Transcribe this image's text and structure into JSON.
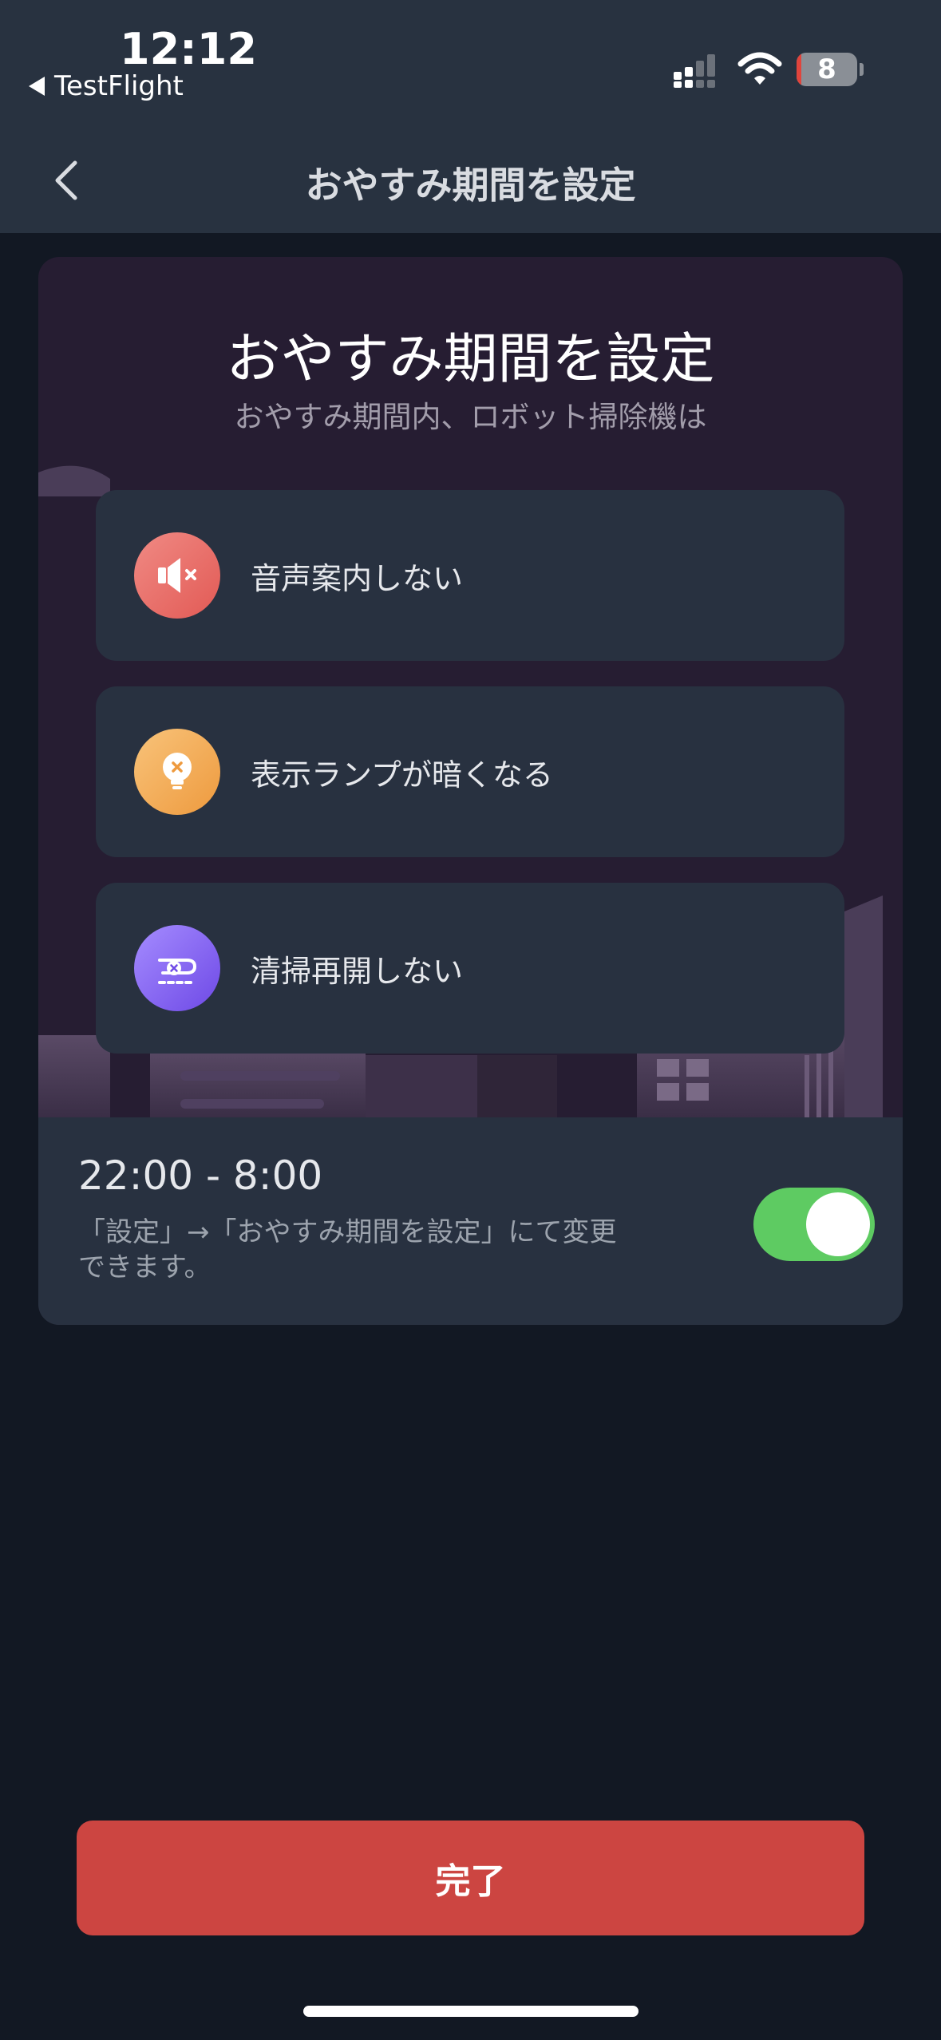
{
  "status_bar": {
    "time": "12:12",
    "back_app": "TestFlight",
    "battery_level": "8",
    "battery_fraction": 0.08
  },
  "nav": {
    "title": "おやすみ期間を設定"
  },
  "card": {
    "title": "おやすみ期間を設定",
    "subtitle": "おやすみ期間内、ロボット掃除機は",
    "features": [
      {
        "label": "音声案内しない",
        "icon": "speaker-mute-icon",
        "color": "#e25a55"
      },
      {
        "label": "表示ランプが暗くなる",
        "icon": "lightbulb-off-icon",
        "color": "#ee9a3e"
      },
      {
        "label": "清掃再開しない",
        "icon": "no-resume-path-icon",
        "color": "#6e49e6"
      }
    ],
    "time_range": "22:00 - 8:00",
    "hint_line1": "「設定」→「おやすみ期間を設定」にて変更",
    "hint_line2": "できます。",
    "toggle_on": true
  },
  "done_button": {
    "label": "完了"
  },
  "colors": {
    "accent": "#cc4541",
    "toggle_on": "#5ecb62",
    "background": "#121823",
    "header": "#283240"
  }
}
